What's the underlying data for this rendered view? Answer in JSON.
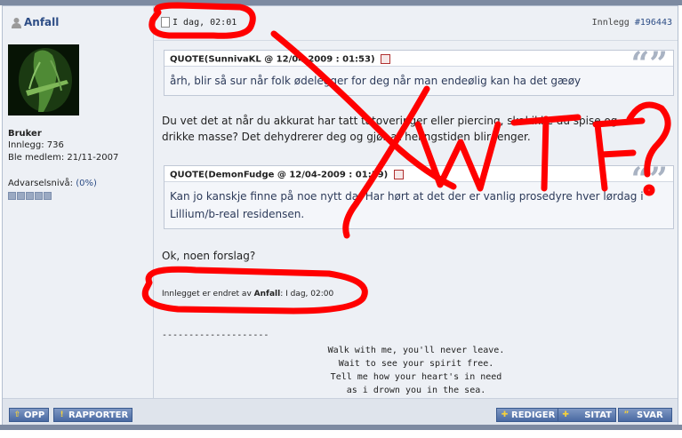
{
  "user": {
    "name": "Anfall",
    "rank": "Bruker",
    "posts_label": "Innlegg: 736",
    "member_label": "Ble medlem: 21/11-2007",
    "warn_label": "Advarselsnivå:",
    "warn_value": "(0%)"
  },
  "post": {
    "date": "I dag, 02:01",
    "number_label": "Innlegg",
    "number": "#196443",
    "quote1": {
      "header": "QUOTE(SunnivaKL @ 12/04-2009 : 01:53)",
      "body": "årh, blir så sur når folk ødelegger for deg når man endeølig kan ha det gæøy"
    },
    "text1_line1": "Du vet det at når du akkurat har tatt tatoveringer eller piercing, skal ikke du spise og",
    "text1_line2": "drikke masse? Det dehydrerer deg og gjør at helingstiden blir lenger.",
    "quote2": {
      "header": "QUOTE(DemonFudge @ 12/04-2009 : 01:59)",
      "body_line1": "Kan jo kanskje finne på noe nytt da. Har hørt at det der er vanlig prosedyre hver lørdag i",
      "body_line2": "Lillium/b-real residensen."
    },
    "text2": "Ok, noen forslag?",
    "edited_prefix": "Innlegget er endret av",
    "edited_by": "Anfall",
    "edited_time": ": I dag, 02:00",
    "sig_separator": "--------------------",
    "sig_lines": [
      "Walk with me, you'll never leave.",
      "Wait to see your spirit free.",
      "Tell me how your heart's in need",
      "as i drown you in the sea."
    ]
  },
  "buttons": {
    "up": "OPP",
    "report": "RAPPORTER",
    "edit": "REDIGER",
    "quote": "SITAT",
    "reply": "SVAR"
  },
  "annotation": {
    "text": "WTF?",
    "color": "#ff0000"
  },
  "colors": {
    "link": "#2d4d86",
    "button": "#4a6aa2",
    "frame_bar": "#7d8aa1"
  }
}
